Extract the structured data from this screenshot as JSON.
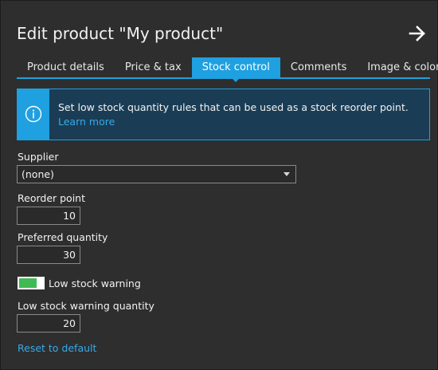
{
  "header": {
    "title": "Edit product \"My product\"",
    "close_icon": "arrow-right-icon"
  },
  "tabs": [
    {
      "label": "Product details",
      "active": false
    },
    {
      "label": "Price & tax",
      "active": false
    },
    {
      "label": "Stock control",
      "active": true
    },
    {
      "label": "Comments",
      "active": false
    },
    {
      "label": "Image & color",
      "active": false
    }
  ],
  "info": {
    "icon": "info-icon",
    "text": "Set low stock quantity rules that can be used as a stock reorder point.",
    "link": "Learn more"
  },
  "supplier": {
    "label": "Supplier",
    "value": "(none)"
  },
  "reorder_point": {
    "label": "Reorder point",
    "value": "10"
  },
  "preferred_quantity": {
    "label": "Preferred quantity",
    "value": "30"
  },
  "low_stock_warning": {
    "label": "Low stock warning",
    "enabled": true
  },
  "low_stock_warning_quantity": {
    "label": "Low stock warning quantity",
    "value": "20"
  },
  "reset_link": "Reset to default",
  "colors": {
    "background": "#2e2e2e",
    "accent": "#1fa0e0",
    "link": "#36a9e8",
    "toggle_on": "#3fba55",
    "info_background": "#1a3d55"
  }
}
